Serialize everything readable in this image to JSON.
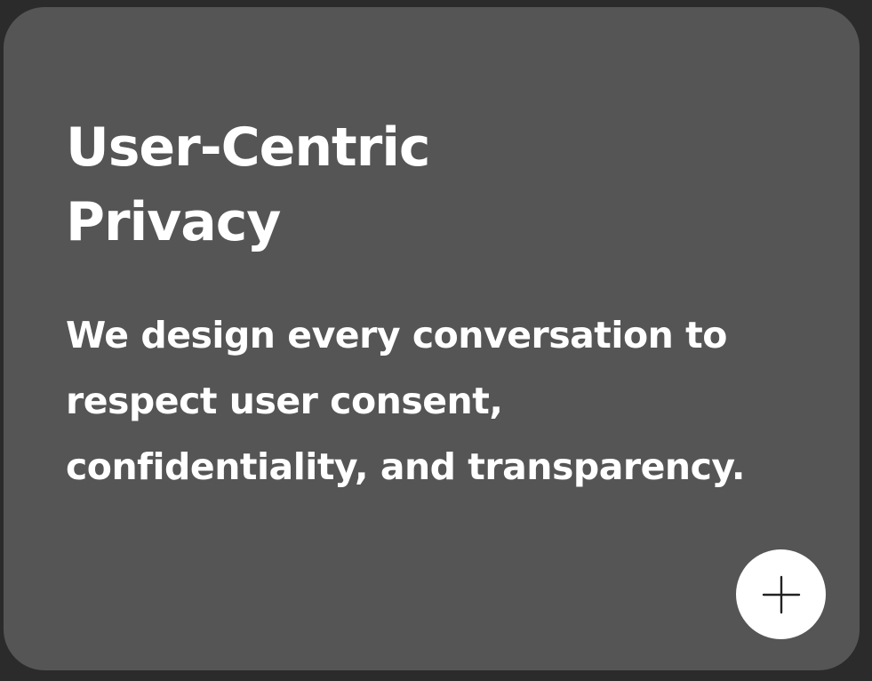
{
  "card": {
    "title_lines": [
      "User-Centric",
      "Privacy"
    ],
    "description_lines": [
      "We design every conversation to",
      "respect user consent,",
      "confidentiality, and transparency."
    ],
    "action_icon": "plus-icon"
  },
  "colors": {
    "background": "#2b2b2b",
    "card": "#555555",
    "text": "#ffffff",
    "button": "#ffffff",
    "icon": "#222222"
  }
}
